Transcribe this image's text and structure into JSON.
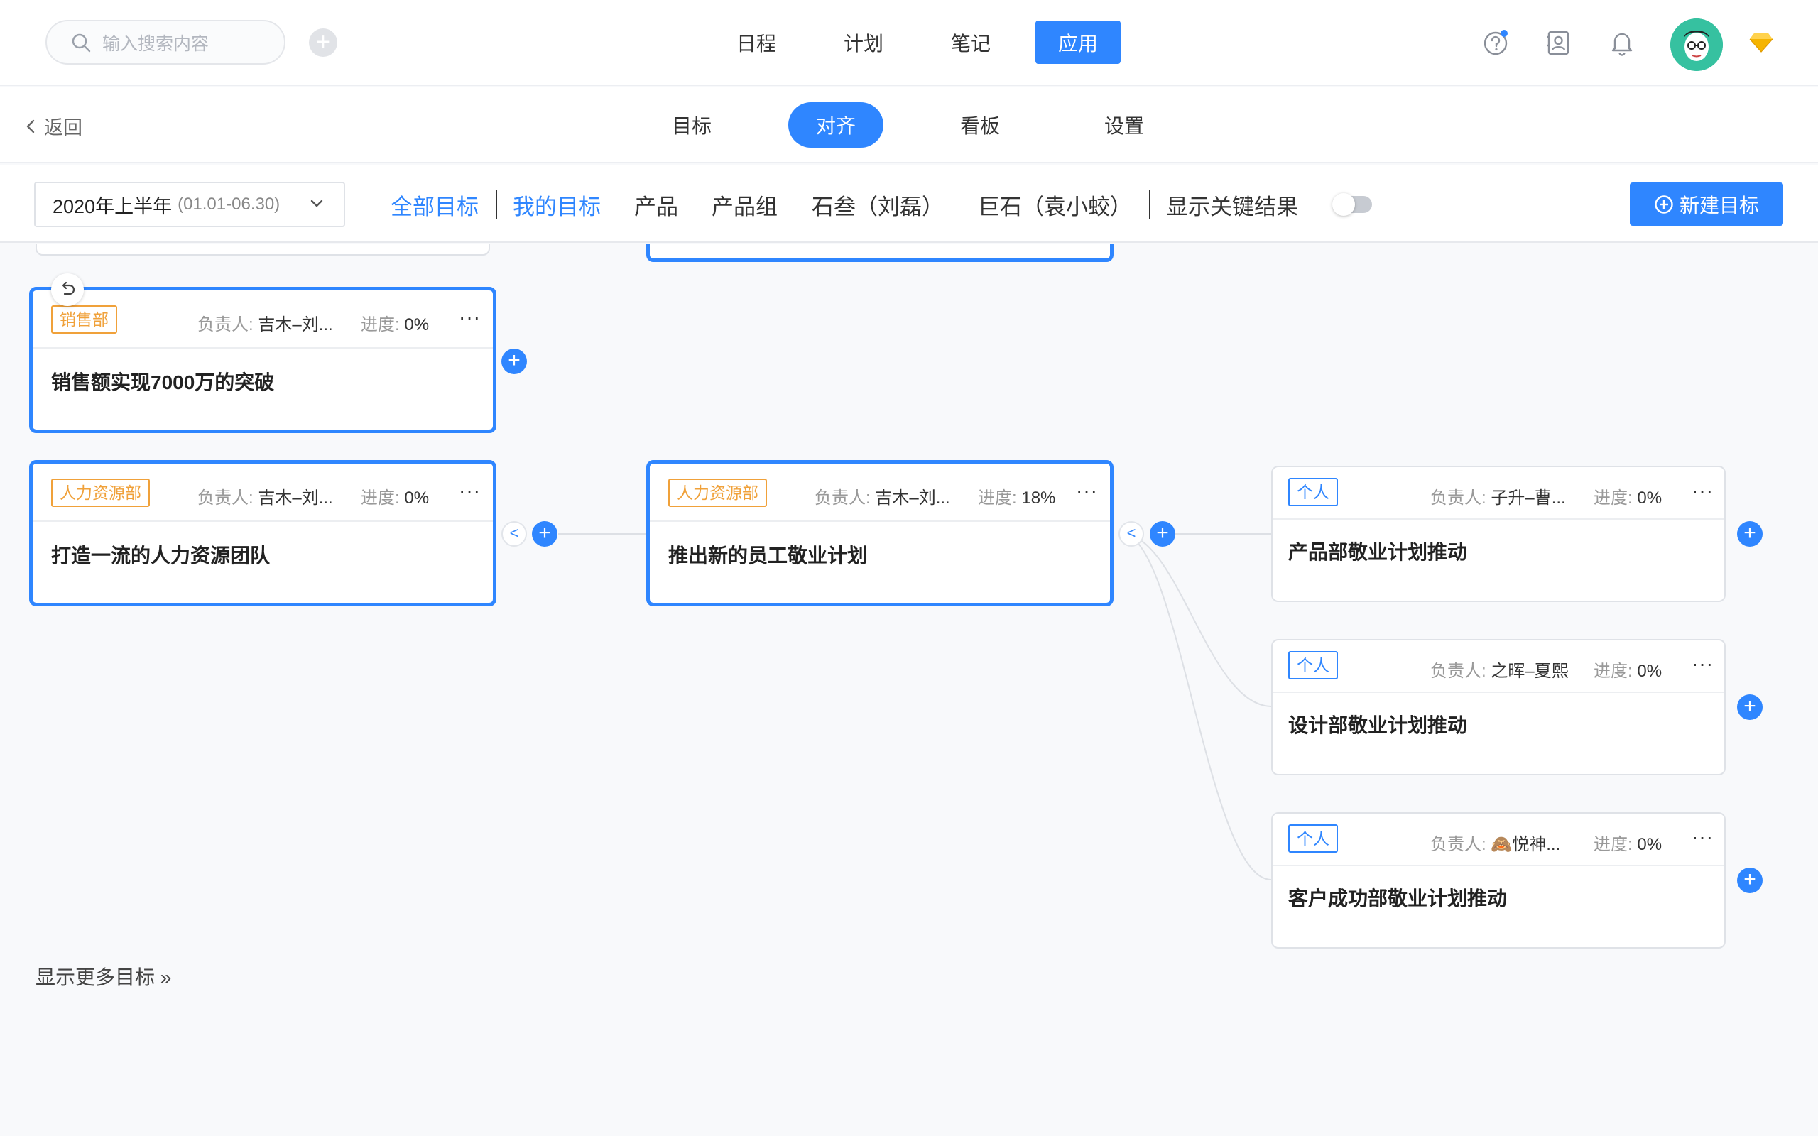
{
  "search": {
    "placeholder": "输入搜索内容"
  },
  "topnav": [
    "日程",
    "计划",
    "笔记",
    "应用"
  ],
  "subnav": {
    "back_label": "返回",
    "tabs": [
      "目标",
      "对齐",
      "看板",
      "设置"
    ]
  },
  "filter": {
    "period_main": "2020年上半年",
    "period_range": "(01.01-06.30)",
    "all_goals": "全部目标",
    "my_goals": "我的目标",
    "product": "产品",
    "product_group": "产品组",
    "shisan": "石叁（刘磊）",
    "jushi": "巨石（袁小蛟）",
    "show_kr": "显示关键结果",
    "new_goal": "新建目标"
  },
  "colors": {
    "accent": "#2f86ff",
    "dept_tag": "#f0a13a",
    "brand_gold": "#f5b400"
  },
  "labels": {
    "owner": "负责人:",
    "progress": "进度:",
    "more": "···"
  },
  "cards": [
    {
      "tag": "销售部",
      "owner": "吉木–刘...",
      "progress": "0%",
      "title": "销售额实现7000万的突破"
    },
    {
      "tag": "人力资源部",
      "owner": "吉木–刘...",
      "progress": "0%",
      "title": "打造一流的人力资源团队"
    },
    {
      "tag": "人力资源部",
      "owner": "吉木–刘...",
      "progress": "18%",
      "title": "推出新的员工敬业计划"
    },
    {
      "tag": "个人",
      "owner": "子升–曹...",
      "progress": "0%",
      "title": "产品部敬业计划推动"
    },
    {
      "tag": "个人",
      "owner": "之晖–夏熙",
      "progress": "0%",
      "title": "设计部敬业计划推动"
    },
    {
      "tag": "个人",
      "owner": "🙈悦神...",
      "progress": "0%",
      "title": "客户成功部敬业计划推动"
    }
  ],
  "show_more": "显示更多目标 »"
}
